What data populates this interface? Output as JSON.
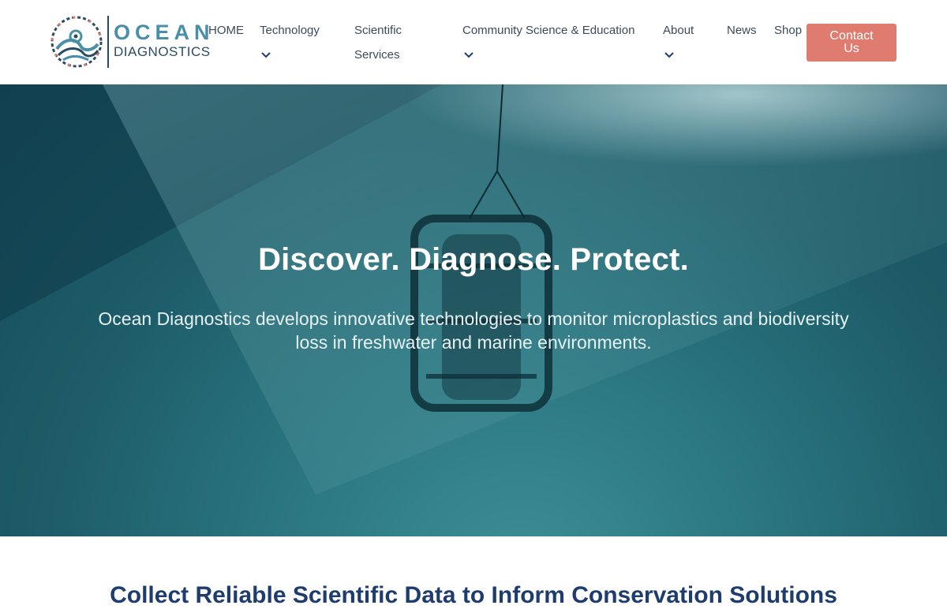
{
  "logo": {
    "word1": "OCEAN",
    "word2": "DIAGNOSTICS"
  },
  "nav": {
    "home": "HOME",
    "technology": "Technology",
    "scientific_line1": "Scientific",
    "scientific_line2": "Services",
    "community": "Community Science & Education",
    "about": "About",
    "news": "News",
    "shop": "Shop",
    "contact": "Contact Us"
  },
  "icons": {
    "dropdown": "chevron-down-icon",
    "logo_mark": "wave-circle-logo"
  },
  "colors": {
    "accent": "#e07b70",
    "brand_teal": "#4a8fa8",
    "brand_navy": "#2b4a66",
    "hero_bg": "#1d5c68"
  },
  "hero": {
    "title": "Discover. Diagnose. Protect.",
    "subtitle": "Ocean Diagnostics develops innovative technologies to monitor microplastics and biodiversity loss in freshwater and marine environments."
  },
  "next_section": {
    "heading": "Collect Reliable Scientific Data to Inform Conservation Solutions"
  }
}
